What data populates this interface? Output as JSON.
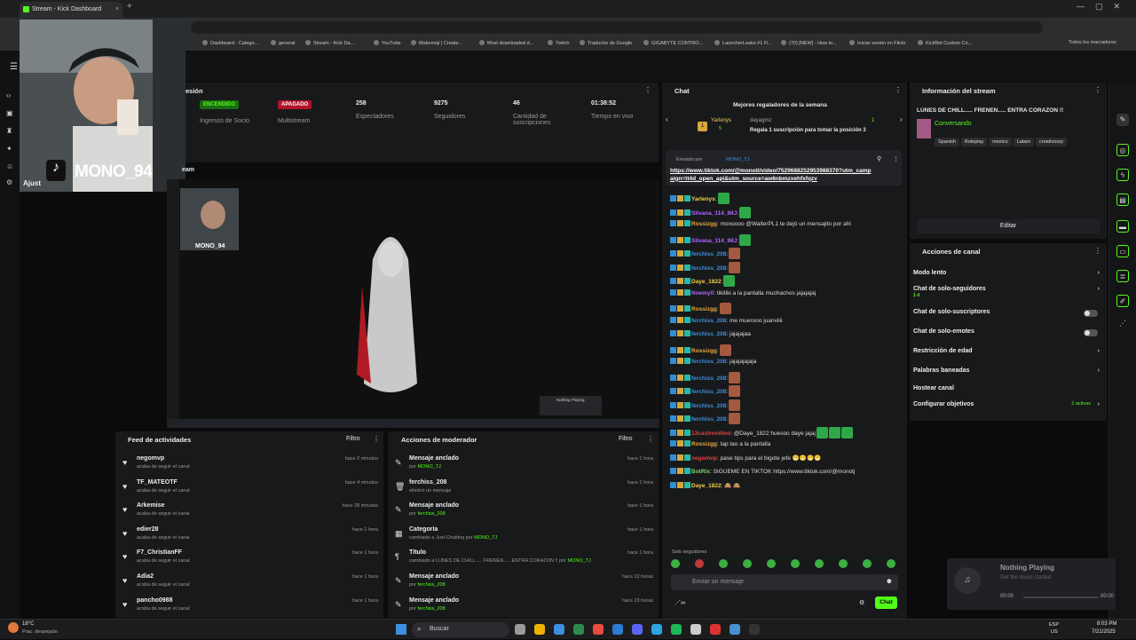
{
  "browser": {
    "tab_title": "Stream - Kick Dashboard",
    "tab_close": "×",
    "new_tab": "+",
    "window_controls": "—▢✕",
    "bookmarks": [
      "Dashboard - Catego...",
      "general",
      "Stream - Kick Da...",
      "YouTube",
      "Makemoji | Create...",
      "Most downloaded d...",
      "Twitch",
      "Traductor de Google",
      "GIGABYTE CONTRO...",
      "LauncherLeaks #1 Fi...",
      "(70) [NEW] - How to...",
      "Iniciar sesión en Flickr",
      "KickBot Custom Co..."
    ],
    "all_bookmarks": "Todos los marcadores"
  },
  "overlay": {
    "cam_name": "MONO_94",
    "settings_label": "Ajust"
  },
  "stream_section_title": "esión",
  "stats": [
    {
      "badge": "ENCENDIDO",
      "label": "Ingresos de Socio",
      "badge_color": "#1a6b12"
    },
    {
      "badge": "APAGADO",
      "label": "Multistream",
      "badge_color": "#b3132a"
    },
    {
      "value": "258",
      "label": "Espectadores"
    },
    {
      "value": "9275",
      "label": "Seguidores"
    },
    {
      "value": "46",
      "label": "Cantidad de suscripciones"
    },
    {
      "value": "01:38:52",
      "label": "Tiempo en vivo"
    }
  ],
  "preview": {
    "label": "eam",
    "mini_cam_name": "MONO_94",
    "player_title": "Nothing Playing"
  },
  "feed": {
    "title": "Feed de actividades",
    "filter": "Filtro",
    "items": [
      {
        "name": "negomvp",
        "sub": "acaba de seguir el canal",
        "time": "hace 2 minutos"
      },
      {
        "name": "TF_MATEOTF",
        "sub": "acaba de seguir el canal",
        "time": "hace 4 minutos"
      },
      {
        "name": "Arkemise",
        "sub": "acaba de seguir el canal",
        "time": "hace 28 minutos"
      },
      {
        "name": "edier28",
        "sub": "acaba de seguir el canal",
        "time": "hace 1 hora"
      },
      {
        "name": "F7_ChristianFF",
        "sub": "acaba de seguir el canal",
        "time": "hace 1 hora"
      },
      {
        "name": "Adia2",
        "sub": "acaba de seguir el canal",
        "time": "hace 1 hora"
      },
      {
        "name": "pancho0988",
        "sub": "acaba de seguir el canal",
        "time": "hace 1 hora"
      }
    ]
  },
  "mod": {
    "title": "Acciones de moderador",
    "filter": "Filtro",
    "items": [
      {
        "icon": "pin",
        "title": "Mensaje anclado",
        "sub": "por ",
        "who": "MONO_TJ",
        "time": "hace 1 hora"
      },
      {
        "icon": "trash",
        "title": "ferchiss_208",
        "sub": "eliminó un mensaje",
        "who": "",
        "time": "hace 1 hora"
      },
      {
        "icon": "pin",
        "title": "Mensaje anclado",
        "sub": "por ",
        "who": "ferchiss_208",
        "time": "hace 1 hora"
      },
      {
        "icon": "category",
        "title": "Categoría",
        "sub": "cambiado a Just Chatting por ",
        "who": "MONO_TJ",
        "time": "hace 1 hora"
      },
      {
        "icon": "title",
        "title": "Título",
        "sub": "cambiado a LUNES DE CHILL..... FRENEN..... ENTRA CORAZON !! por ",
        "who": "MONO_TJ",
        "time": "hace 1 hora"
      },
      {
        "icon": "pin",
        "title": "Mensaje anclado",
        "sub": "por ",
        "who": "ferchiss_208",
        "time": "hace 22 horas"
      },
      {
        "icon": "pin",
        "title": "Mensaje anclado",
        "sub": "por ",
        "who": "ferchiss_208",
        "time": "hace 23 horas"
      }
    ]
  },
  "chat": {
    "title": "Chat",
    "gifters_title": "Mejores regaladores de la semana",
    "gifter_rank": "1",
    "gifter_name": "Yarlenys",
    "gifter_count": "5",
    "gifter_you": "dayagmz",
    "gifter_you_count": "1",
    "gifter_prompt": "Regala 1 suscripción para tomar la posición 3",
    "pinned_by": "Enviado por",
    "pinned_user": "MONO_TJ",
    "pinned_link": "https://www.tiktok.com/@monoti/video/7529688252953988370?utm_campaign=tt4d_open_api&utm_source=aw6nbmzxehfxfqzv",
    "messages": [
      {
        "user": "Yarlenys",
        "color": "#f0d04a",
        "text": ":",
        "emotes": 1
      },
      {
        "user": "Silvana_114_IMJ",
        "color": "#b067ff",
        "text": ":",
        "emotes": 1
      },
      {
        "user": "Rossizgg",
        "color": "#e8a93a",
        "text": ": monoooo @WalterPL1 te dejó un mensajito por ahi",
        "emotes": 0
      },
      {
        "user": "Silvana_114_IMJ",
        "color": "#b067ff",
        "text": ":",
        "emotes": 1
      },
      {
        "user": "ferchiss_208",
        "color": "#3d8fe0",
        "text": ":",
        "emotes": 1
      },
      {
        "user": "ferchiss_208",
        "color": "#3d8fe0",
        "text": ":",
        "emotes": 1
      },
      {
        "user": "Daye_1822",
        "color": "#f0d04a",
        "text": ":",
        "emotes": 1
      },
      {
        "user": "Noemy0",
        "color": "#b067ff",
        "text": ": tikitiki a la pantalla muchachos jajajajaj",
        "emotes": 0
      },
      {
        "user": "Rossizgg",
        "color": "#e8a93a",
        "text": ":",
        "emotes": 1
      },
      {
        "user": "ferchiss_208",
        "color": "#3d8fe0",
        "text": ": me muerooo juanviiii",
        "emotes": 0
      },
      {
        "user": "ferchiss_208",
        "color": "#3d8fe0",
        "text": ": jajajajaa",
        "emotes": 0
      },
      {
        "user": "Rossizgg",
        "color": "#e8a93a",
        "text": ":",
        "emotes": 1
      },
      {
        "user": "ferchiss_208",
        "color": "#3d8fe0",
        "text": ": jajajajajaja",
        "emotes": 0
      },
      {
        "user": "ferchiss_208",
        "color": "#3d8fe0",
        "text": ":",
        "emotes": 1
      },
      {
        "user": "ferchiss_208",
        "color": "#3d8fe0",
        "text": ":",
        "emotes": 1
      },
      {
        "user": "ferchiss_208",
        "color": "#3d8fe0",
        "text": ":",
        "emotes": 1
      },
      {
        "user": "ferchiss_208",
        "color": "#3d8fe0",
        "text": ":",
        "emotes": 1
      },
      {
        "user": "13castronilloo",
        "color": "#e0433d",
        "text": ": @Daye_1822 huesoo daye jajaj",
        "emotes": 3
      },
      {
        "user": "Rossizgg",
        "color": "#e8a93a",
        "text": ": tap tao a la pantalla",
        "emotes": 0
      },
      {
        "user": "negomvp",
        "color": "#e0433d",
        "text": ": pase tips para el bigote jefe 😁😁😁😁",
        "emotes": 0
      },
      {
        "user": "BotRix",
        "color": "#7fd36b",
        "text": ": SIGUEME EN TIKTOK https://www.tiktok.com/@monotj",
        "emotes": 0
      },
      {
        "user": "Daye_1822",
        "color": "#f0d04a",
        "text": ": 🙈 🙈",
        "emotes": 0
      }
    ],
    "followers_only": "Solo seguidores",
    "input_placeholder": "Enviar un mensaje",
    "send": "Chat"
  },
  "info": {
    "title": "Información del stream",
    "stream_title": "LUNES DE CHILL..... FRENEN..... ENTRA CORAZON !!",
    "category": "Conversando",
    "tags": [
      "Spanish",
      "Roleplay",
      "mexico",
      "Latam",
      "creativosrp"
    ],
    "edit": "Editar"
  },
  "actions": {
    "title": "Acciones de canal",
    "items": [
      {
        "label": "Modo lento",
        "kind": "chev",
        "sub": ""
      },
      {
        "label": "Chat de solo-seguidores",
        "kind": "chev",
        "sub": "1 d"
      },
      {
        "label": "Chat de solo-suscriptores",
        "kind": "toggle",
        "sub": ""
      },
      {
        "label": "Chat de solo-emotes",
        "kind": "toggle",
        "sub": ""
      },
      {
        "label": "Restricción de edad",
        "kind": "chev",
        "sub": ""
      },
      {
        "label": "Palabras baneadas",
        "kind": "chev",
        "sub": ""
      },
      {
        "label": "Hostear canal",
        "kind": "none",
        "sub": ""
      },
      {
        "label": "Configurar objetivos",
        "kind": "chev",
        "sub": "2 activas"
      }
    ]
  },
  "music": {
    "title": "Nothing Playing",
    "subtitle": "Get the music started",
    "time_start": "00:00",
    "time_end": "00:00"
  },
  "taskbar": {
    "weather_temp": "18°C",
    "weather_desc": "Prac. despejado",
    "search": "Buscar",
    "lang1": "ESP",
    "lang2": "US",
    "time": "8:03 PM",
    "date": "7/21/2025"
  },
  "colors": {
    "accent": "#53fc18",
    "bg": "#0b0b0c",
    "panel": "#18191b"
  }
}
